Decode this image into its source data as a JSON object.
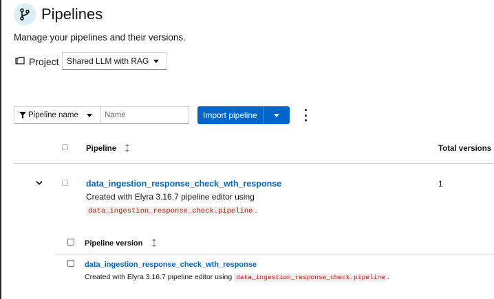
{
  "header": {
    "icon": "pipeline-branch-icon",
    "title": "Pipelines",
    "description": "Manage your pipelines and their versions."
  },
  "project": {
    "label": "Project",
    "selected": "Shared LLM with RAG"
  },
  "toolbar": {
    "filter_type": "Pipeline name",
    "filter_placeholder": "Name",
    "import_label": "Import pipeline"
  },
  "table": {
    "columns": {
      "pipeline": "Pipeline",
      "total_versions": "Total versions"
    },
    "rows": [
      {
        "name": "data_ingestion_response_check_wth_response",
        "desc_prefix": "Created with Elyra 3.16.7 pipeline editor using",
        "desc_file": "data_ingestion_response_check.pipeline",
        "desc_suffix": ".",
        "total_versions": "1",
        "versions_header": "Pipeline version",
        "versions": [
          {
            "name": "data_ingestion_response_check_wth_response",
            "desc_prefix": "Created with Elyra 3.16.7 pipeline editor using",
            "desc_file": "data_ingestion_response_check.pipeline",
            "desc_suffix": "."
          }
        ]
      }
    ]
  },
  "colors": {
    "accent": "#0066cc",
    "code_text": "#c9190b",
    "icon_bg": "#d9eff5"
  }
}
